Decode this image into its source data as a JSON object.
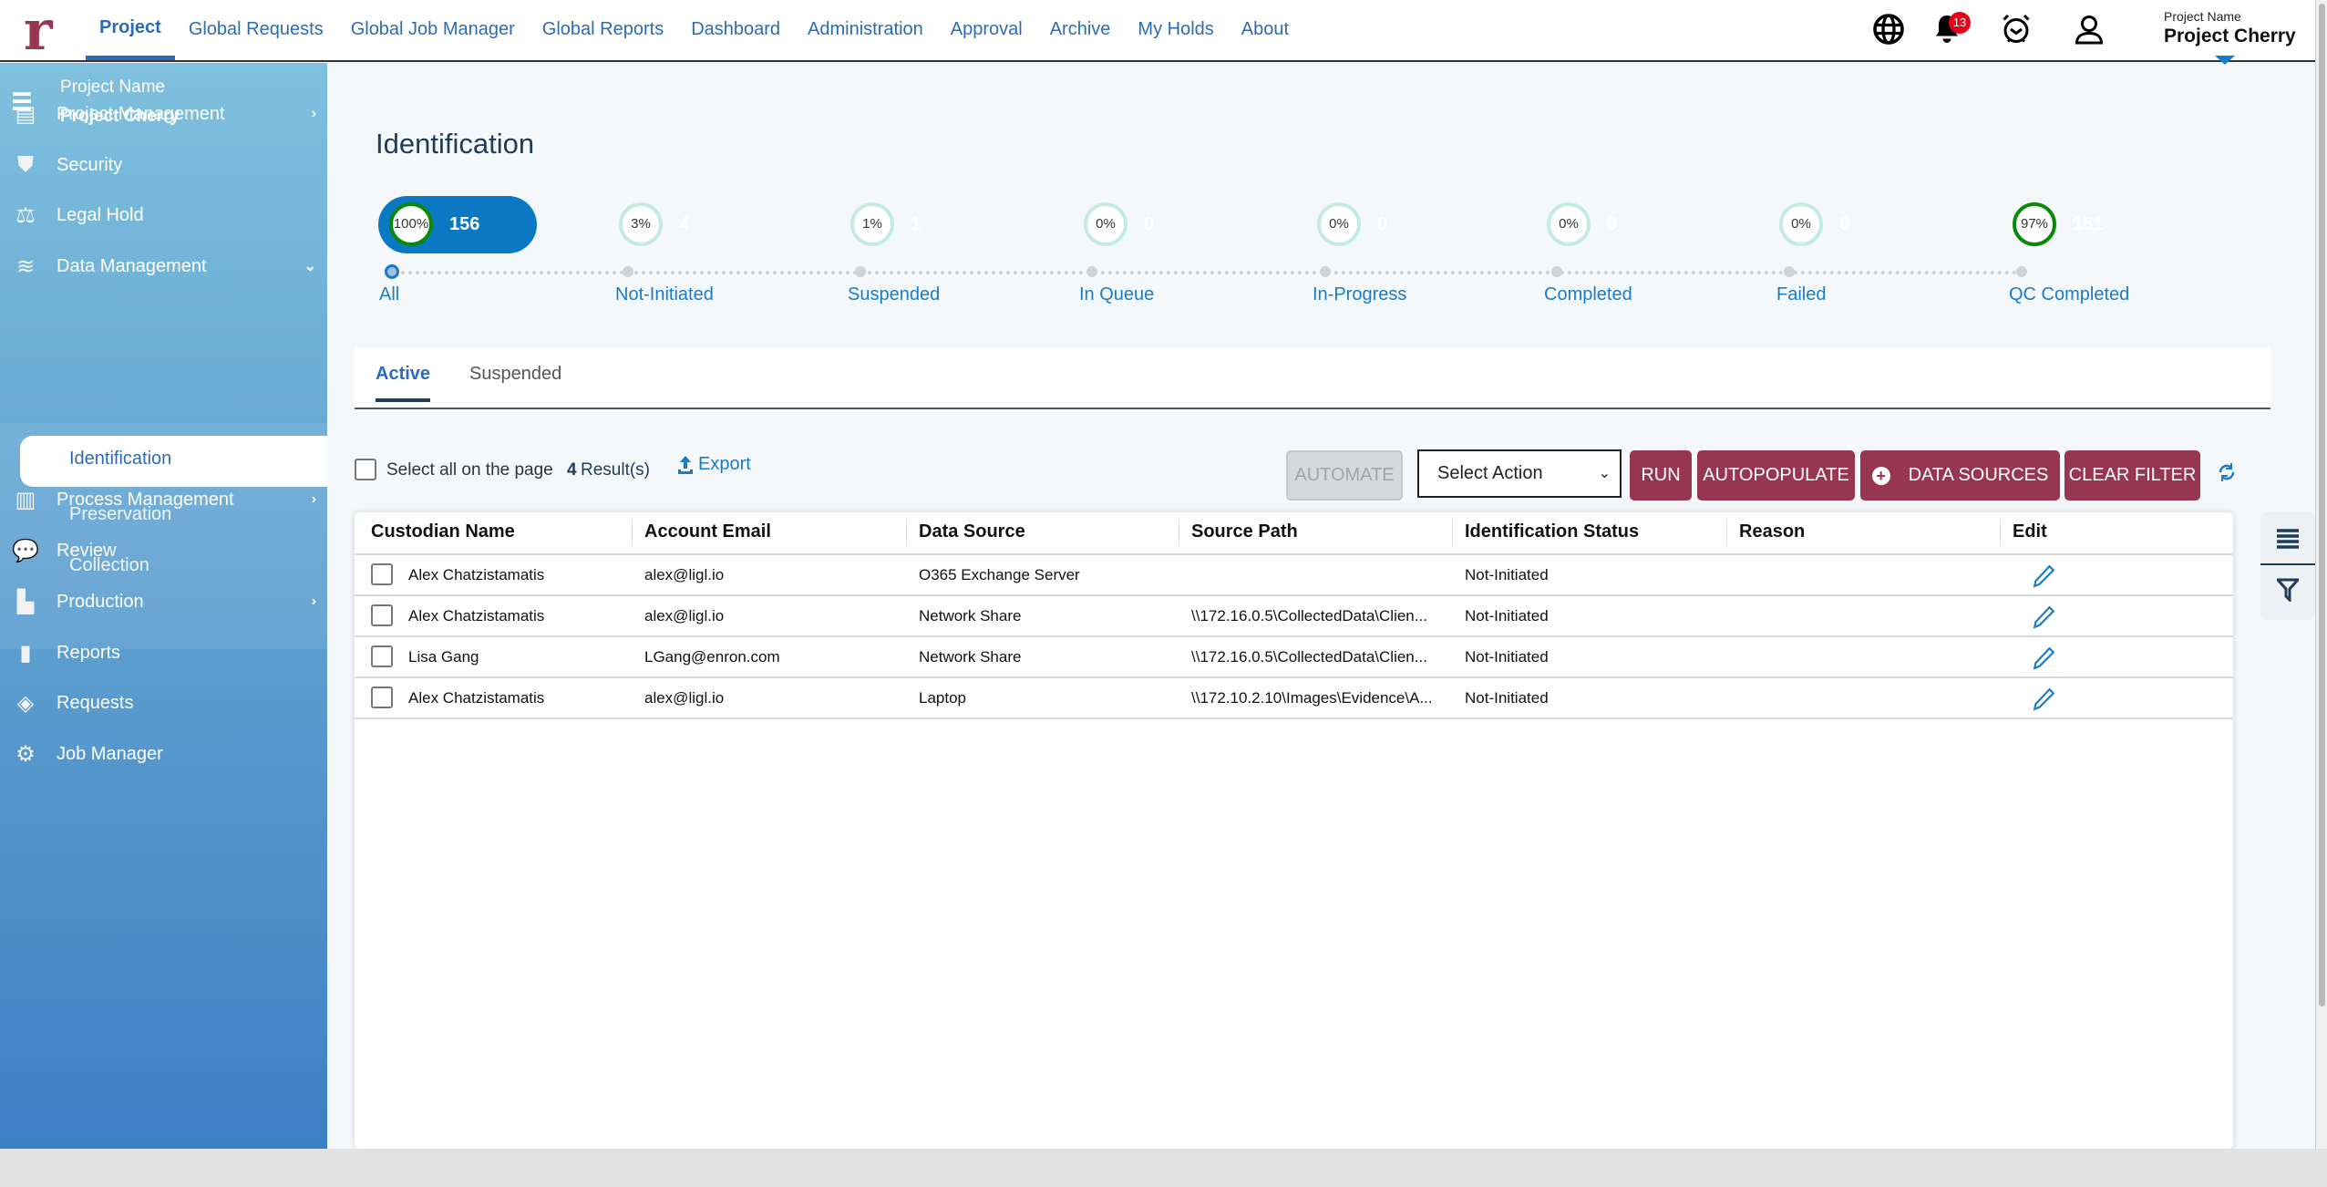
{
  "header": {
    "logo": "r",
    "nav": [
      {
        "label": "Project",
        "active": true
      },
      {
        "label": "Global Requests"
      },
      {
        "label": "Global Job Manager"
      },
      {
        "label": "Global Reports"
      },
      {
        "label": "Dashboard"
      },
      {
        "label": "Administration"
      },
      {
        "label": "Approval"
      },
      {
        "label": "Archive"
      },
      {
        "label": "My Holds"
      },
      {
        "label": "About"
      }
    ],
    "icons": [
      "globe-icon",
      "bell-icon",
      "alarm-clock-icon",
      "user-icon"
    ],
    "notification_count": "13",
    "project_label": "Project Name",
    "project_name": "Project Cherry"
  },
  "sidebar": {
    "project_label": "Project Name",
    "project_name": "Project Cherry",
    "items": [
      {
        "label": "Project Management",
        "icon": "server-icon",
        "chevron": "›"
      },
      {
        "label": "Security",
        "icon": "shield-icon"
      },
      {
        "label": "Legal Hold",
        "icon": "scale-icon"
      },
      {
        "label": "Data Management",
        "icon": "database-icon",
        "chevron": "⌄",
        "expanded": true
      },
      {
        "label": "Process Management",
        "icon": "chip-icon",
        "chevron": "›"
      },
      {
        "label": "Review",
        "icon": "comments-icon"
      },
      {
        "label": "Production",
        "icon": "factory-icon",
        "chevron": "›"
      },
      {
        "label": "Reports",
        "icon": "bar-chart-icon"
      },
      {
        "label": "Requests",
        "icon": "ticket-icon"
      },
      {
        "label": "Job Manager",
        "icon": "gear-icon"
      }
    ],
    "subitems": [
      {
        "label": "Identification",
        "active": true
      },
      {
        "label": "Preservation"
      },
      {
        "label": "Collection"
      }
    ]
  },
  "page": {
    "title": "Identification"
  },
  "steps": [
    {
      "label": "All",
      "percent": "100%",
      "count": "156",
      "selected": true
    },
    {
      "label": "Not-Initiated",
      "percent": "3%",
      "count": "4"
    },
    {
      "label": "Suspended",
      "percent": "1%",
      "count": "1"
    },
    {
      "label": "In Queue",
      "percent": "0%",
      "count": "0"
    },
    {
      "label": "In-Progress",
      "percent": "0%",
      "count": "0"
    },
    {
      "label": "Completed",
      "percent": "0%",
      "count": "0"
    },
    {
      "label": "Failed",
      "percent": "0%",
      "count": "0"
    },
    {
      "label": "QC Completed",
      "percent": "97%",
      "count": "151"
    }
  ],
  "tabs": [
    {
      "label": "Active",
      "active": true
    },
    {
      "label": "Suspended"
    }
  ],
  "toolbar": {
    "select_all": "Select all on the page",
    "result_count": "4",
    "result_label": "Result(s)",
    "export": "Export",
    "automate": "AUTOMATE",
    "select_action": "Select Action",
    "run": "RUN",
    "autopopulate": "AUTOPOPULATE",
    "data_sources": "DATA SOURCES",
    "clear_filter": "CLEAR FILTER"
  },
  "table": {
    "columns": [
      "Custodian Name",
      "Account Email",
      "Data Source",
      "Source Path",
      "Identification Status",
      "Reason",
      "Edit"
    ],
    "rows": [
      [
        "Alex Chatzistamatis",
        "alex@ligl.io",
        "O365 Exchange Server",
        "",
        "Not-Initiated",
        ""
      ],
      [
        "Alex Chatzistamatis",
        "alex@ligl.io",
        "Network Share",
        "\\\\172.16.0.5\\CollectedData\\Clien...",
        "Not-Initiated",
        ""
      ],
      [
        "Lisa Gang",
        "LGang@enron.com",
        "Network Share",
        "\\\\172.16.0.5\\CollectedData\\Clien...",
        "Not-Initiated",
        ""
      ],
      [
        "Alex Chatzistamatis",
        "alex@ligl.io",
        "Laptop",
        "\\\\172.10.2.10\\Images\\Evidence\\A...",
        "Not-Initiated",
        ""
      ]
    ]
  },
  "colors": {
    "accent": "#2b6cb5",
    "brand": "#963651",
    "pill": "#0a78c2",
    "ring_green": "#0a8a0a"
  }
}
